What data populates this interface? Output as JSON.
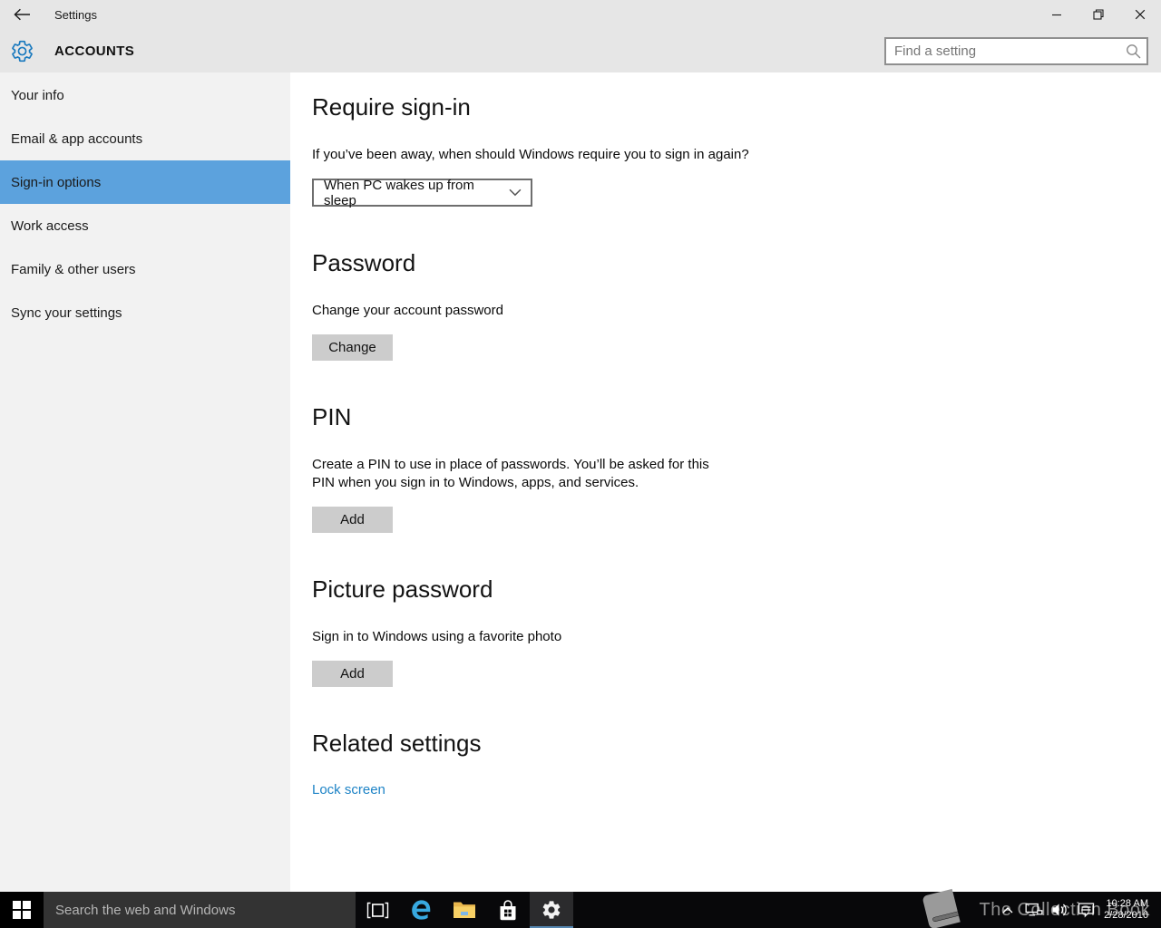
{
  "titlebar": {
    "title": "Settings"
  },
  "header": {
    "page_title": "ACCOUNTS",
    "search": {
      "placeholder": "Find a setting"
    }
  },
  "sidebar": {
    "items": [
      {
        "label": "Your info",
        "selected": false
      },
      {
        "label": "Email & app accounts",
        "selected": false
      },
      {
        "label": "Sign-in options",
        "selected": true
      },
      {
        "label": "Work access",
        "selected": false
      },
      {
        "label": "Family & other users",
        "selected": false
      },
      {
        "label": "Sync your settings",
        "selected": false
      }
    ]
  },
  "main": {
    "require_signin": {
      "title": "Require sign-in",
      "description": "If you’ve been away, when should Windows require you to sign in again?",
      "dropdown_value": "When PC wakes up from sleep"
    },
    "password": {
      "title": "Password",
      "description": "Change your account password",
      "button": "Change"
    },
    "pin": {
      "title": "PIN",
      "description": "Create a PIN to use in place of passwords. You’ll be asked for this PIN when you sign in to Windows, apps, and services.",
      "button": "Add"
    },
    "picture_password": {
      "title": "Picture password",
      "description": "Sign in to Windows using a favorite photo",
      "button": "Add"
    },
    "related_settings": {
      "title": "Related settings",
      "link": "Lock screen"
    }
  },
  "taskbar": {
    "search_placeholder": "Search the web and Windows",
    "clock": {
      "time": "10:28 AM",
      "date": "2/28/2016"
    }
  },
  "watermark": {
    "text": "The Collection Book"
  },
  "colors": {
    "accent_blue": "#1979be",
    "sidebar_selected_blue": "#5ca2dd",
    "link_blue": "#1d83c6",
    "edge_blue": "#38a9e0",
    "folder_yellow": "#f7d065",
    "taskbar_active_underline": "#5586b0",
    "header_gray": "#e6e6e6",
    "sidebar_gray": "#f2f2f2"
  },
  "icons": {
    "back": "left-arrow",
    "minimize": "horizontal-line",
    "restore": "overlapping-squares",
    "close": "x-cross",
    "settings_gear": "gear-outline",
    "find_search": "magnifier",
    "dropdown_chevron": "chevron-down",
    "start": "windows-logo",
    "task_view": "bracketed-square",
    "edge": "edge-e",
    "file_explorer": "folder",
    "store": "shopping-bag-windows-logo",
    "taskbar_settings": "gear",
    "tray_expand": "chevron-up",
    "tray_network": "monitor-plug",
    "tray_volume": "speaker-waves",
    "tray_action_center": "message-square",
    "watermark_book": "book"
  }
}
